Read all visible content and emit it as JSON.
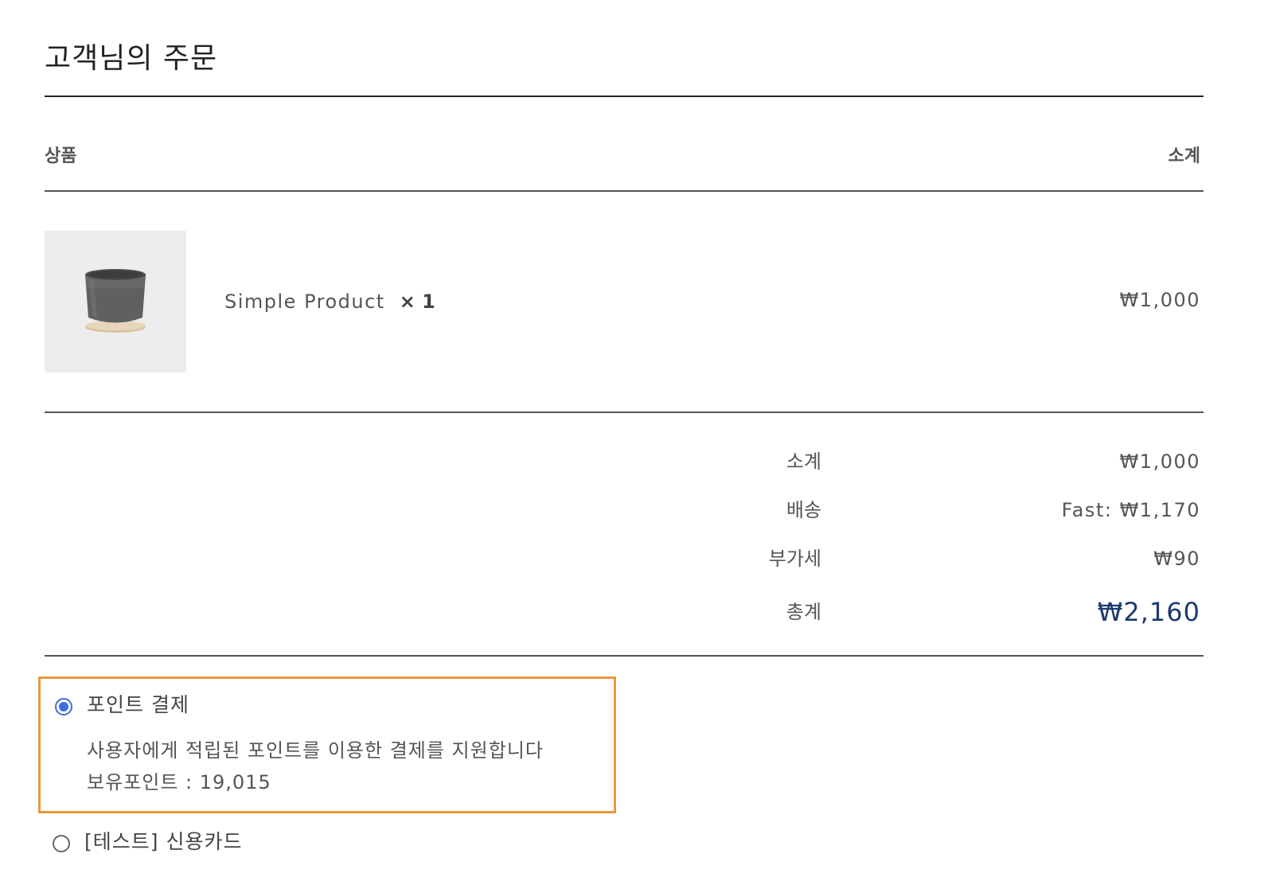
{
  "order": {
    "title": "고객님의 주문",
    "columns": {
      "product": "상품",
      "subtotal": "소계"
    },
    "items": [
      {
        "name": "Simple Product",
        "quantity": "× 1",
        "total": "₩1,000",
        "thumbnail_icon": "gray-pot-with-wooden-saucer"
      }
    ],
    "summary": {
      "subtotal_label": "소계",
      "subtotal_value": "₩1,000",
      "shipping_label": "배송",
      "shipping_value": "Fast: ₩1,170",
      "tax_label": "부가세",
      "tax_value": "₩90",
      "total_label": "총계",
      "total_value": "₩2,160"
    }
  },
  "payment": {
    "methods": [
      {
        "label": "포인트 결제",
        "selected": true,
        "description": "사용자에게 적립된 포인트를 이용한 결제를 지원합니다",
        "points_line": "보유포인트 : 19,015"
      },
      {
        "label": "[테스트] 신용카드",
        "selected": false
      }
    ],
    "colors": {
      "highlight_border": "#e8993a",
      "radio_selected": "#3b6fe0",
      "total_text": "#1e3a6e"
    }
  }
}
